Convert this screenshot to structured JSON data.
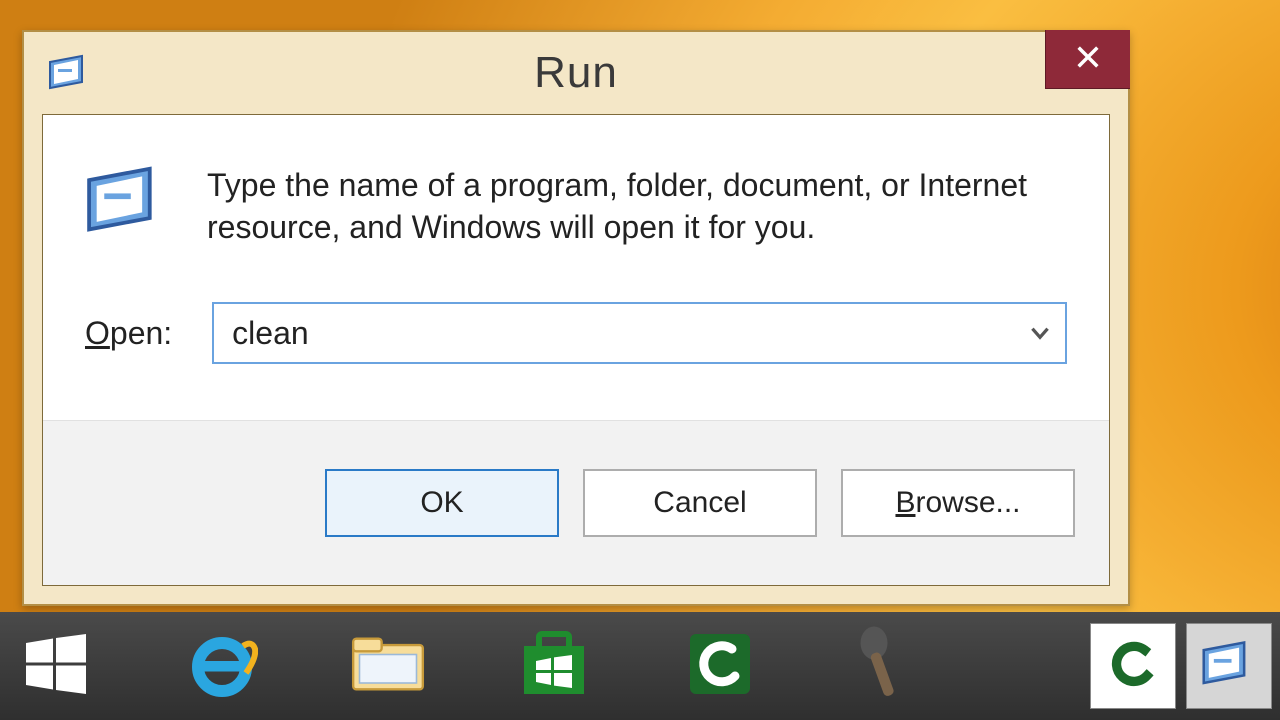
{
  "dialog": {
    "title": "Run",
    "description": "Type the name of a program, folder, document, or Internet resource, and Windows will open it for you.",
    "open_label": "Open:",
    "input_value": "clean",
    "buttons": {
      "ok": "OK",
      "cancel": "Cancel",
      "browse": "Browse..."
    }
  },
  "taskbar": {
    "start": "Start",
    "ie": "Internet Explorer",
    "explorer": "File Explorer",
    "store": "Store",
    "camtasia": "Camtasia",
    "mic": "Microphone",
    "camtasia_right": "Camtasia Studio",
    "run_right": "Run"
  }
}
